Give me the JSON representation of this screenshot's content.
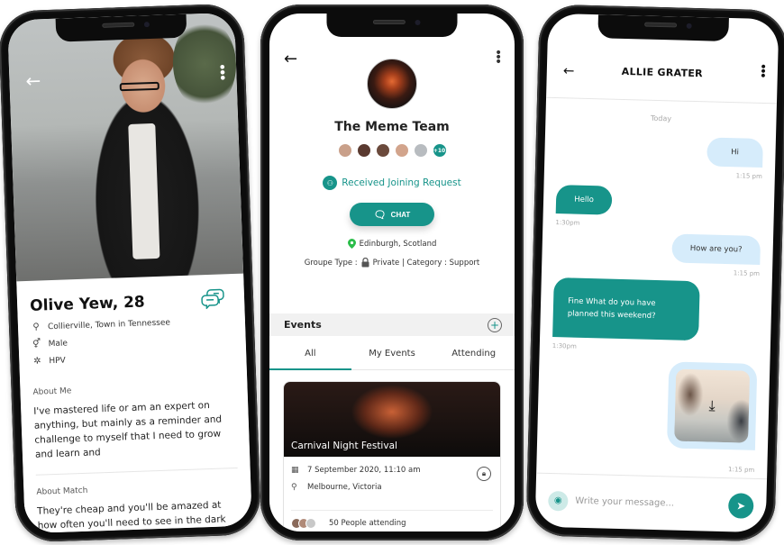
{
  "theme": {
    "accent": "#17948a",
    "outgoing_bubble": "#d6ecfb",
    "location_pin": "#2bbd4a"
  },
  "profile": {
    "back_icon": "←",
    "more_icon": "⋮",
    "name": "Olive Yew, 28",
    "chat_icon": "chat-bubbles-icon",
    "details": [
      {
        "icon": "map-pin-icon",
        "glyph": "⚲",
        "text": "Collierville, Town in Tennessee"
      },
      {
        "icon": "gender-icon",
        "glyph": "⚥",
        "text": "Male"
      },
      {
        "icon": "virus-icon",
        "glyph": "✲",
        "text": "HPV"
      }
    ],
    "about_me_label": "About Me",
    "about_me_text": "I've mastered life or am an expert on anything, but mainly as a reminder and challenge to myself that I need to grow and learn and",
    "about_match_label": "About Match",
    "about_match_text": "They're cheap and you'll be amazed at how often you'll need to see in the dark while also having both hands free."
  },
  "group": {
    "back_icon": "←",
    "more_icon": "⋮",
    "title": "The Meme Team",
    "members_more": "+10",
    "member_colors": [
      "#c9a08a",
      "#5a3a30",
      "#6b4a3c",
      "#d2a48c",
      "#b8bcc0"
    ],
    "joining_request": "Received Joining Request",
    "chat_button": "CHAT",
    "chat_icon": "🗨",
    "location": "Edinburgh, Scotland",
    "pin_glyph": "⬤",
    "type_prefix": "Groupe Type :",
    "lock_glyph": "🔒",
    "type_value": "Private | Category : Support",
    "events_header": "Events",
    "add_icon": "+",
    "tabs": [
      {
        "label": "All",
        "active": true
      },
      {
        "label": "My Events",
        "active": false
      },
      {
        "label": "Attending",
        "active": false
      }
    ],
    "event": {
      "title": "Carnival Night Festival",
      "date": "7 September 2020, 11:10 am",
      "location": "Melbourne, Victoria",
      "attending": "50 People attending",
      "attendee_colors": [
        "#8a6a5a",
        "#b08a78",
        "#c8c8c8"
      ]
    }
  },
  "chat": {
    "back_icon": "←",
    "more_icon": "⋮",
    "contact_name": "ALLIE GRATER",
    "day_label": "Today",
    "messages": [
      {
        "dir": "out",
        "text": "Hi",
        "time": "1:15 pm"
      },
      {
        "dir": "in",
        "text": "Hello",
        "time": "1:30pm"
      },
      {
        "dir": "out",
        "text": "How are you?",
        "time": "1:15 pm"
      },
      {
        "dir": "in",
        "text": "Fine What do you have planned this weekend?",
        "time": "1:30pm"
      },
      {
        "dir": "out",
        "type": "image",
        "time": "1:15 pm"
      }
    ],
    "download_icon": "⤓",
    "camera_icon": "📷",
    "input_placeholder": "Write your message...",
    "input_value": "",
    "send_icon": "➤"
  }
}
